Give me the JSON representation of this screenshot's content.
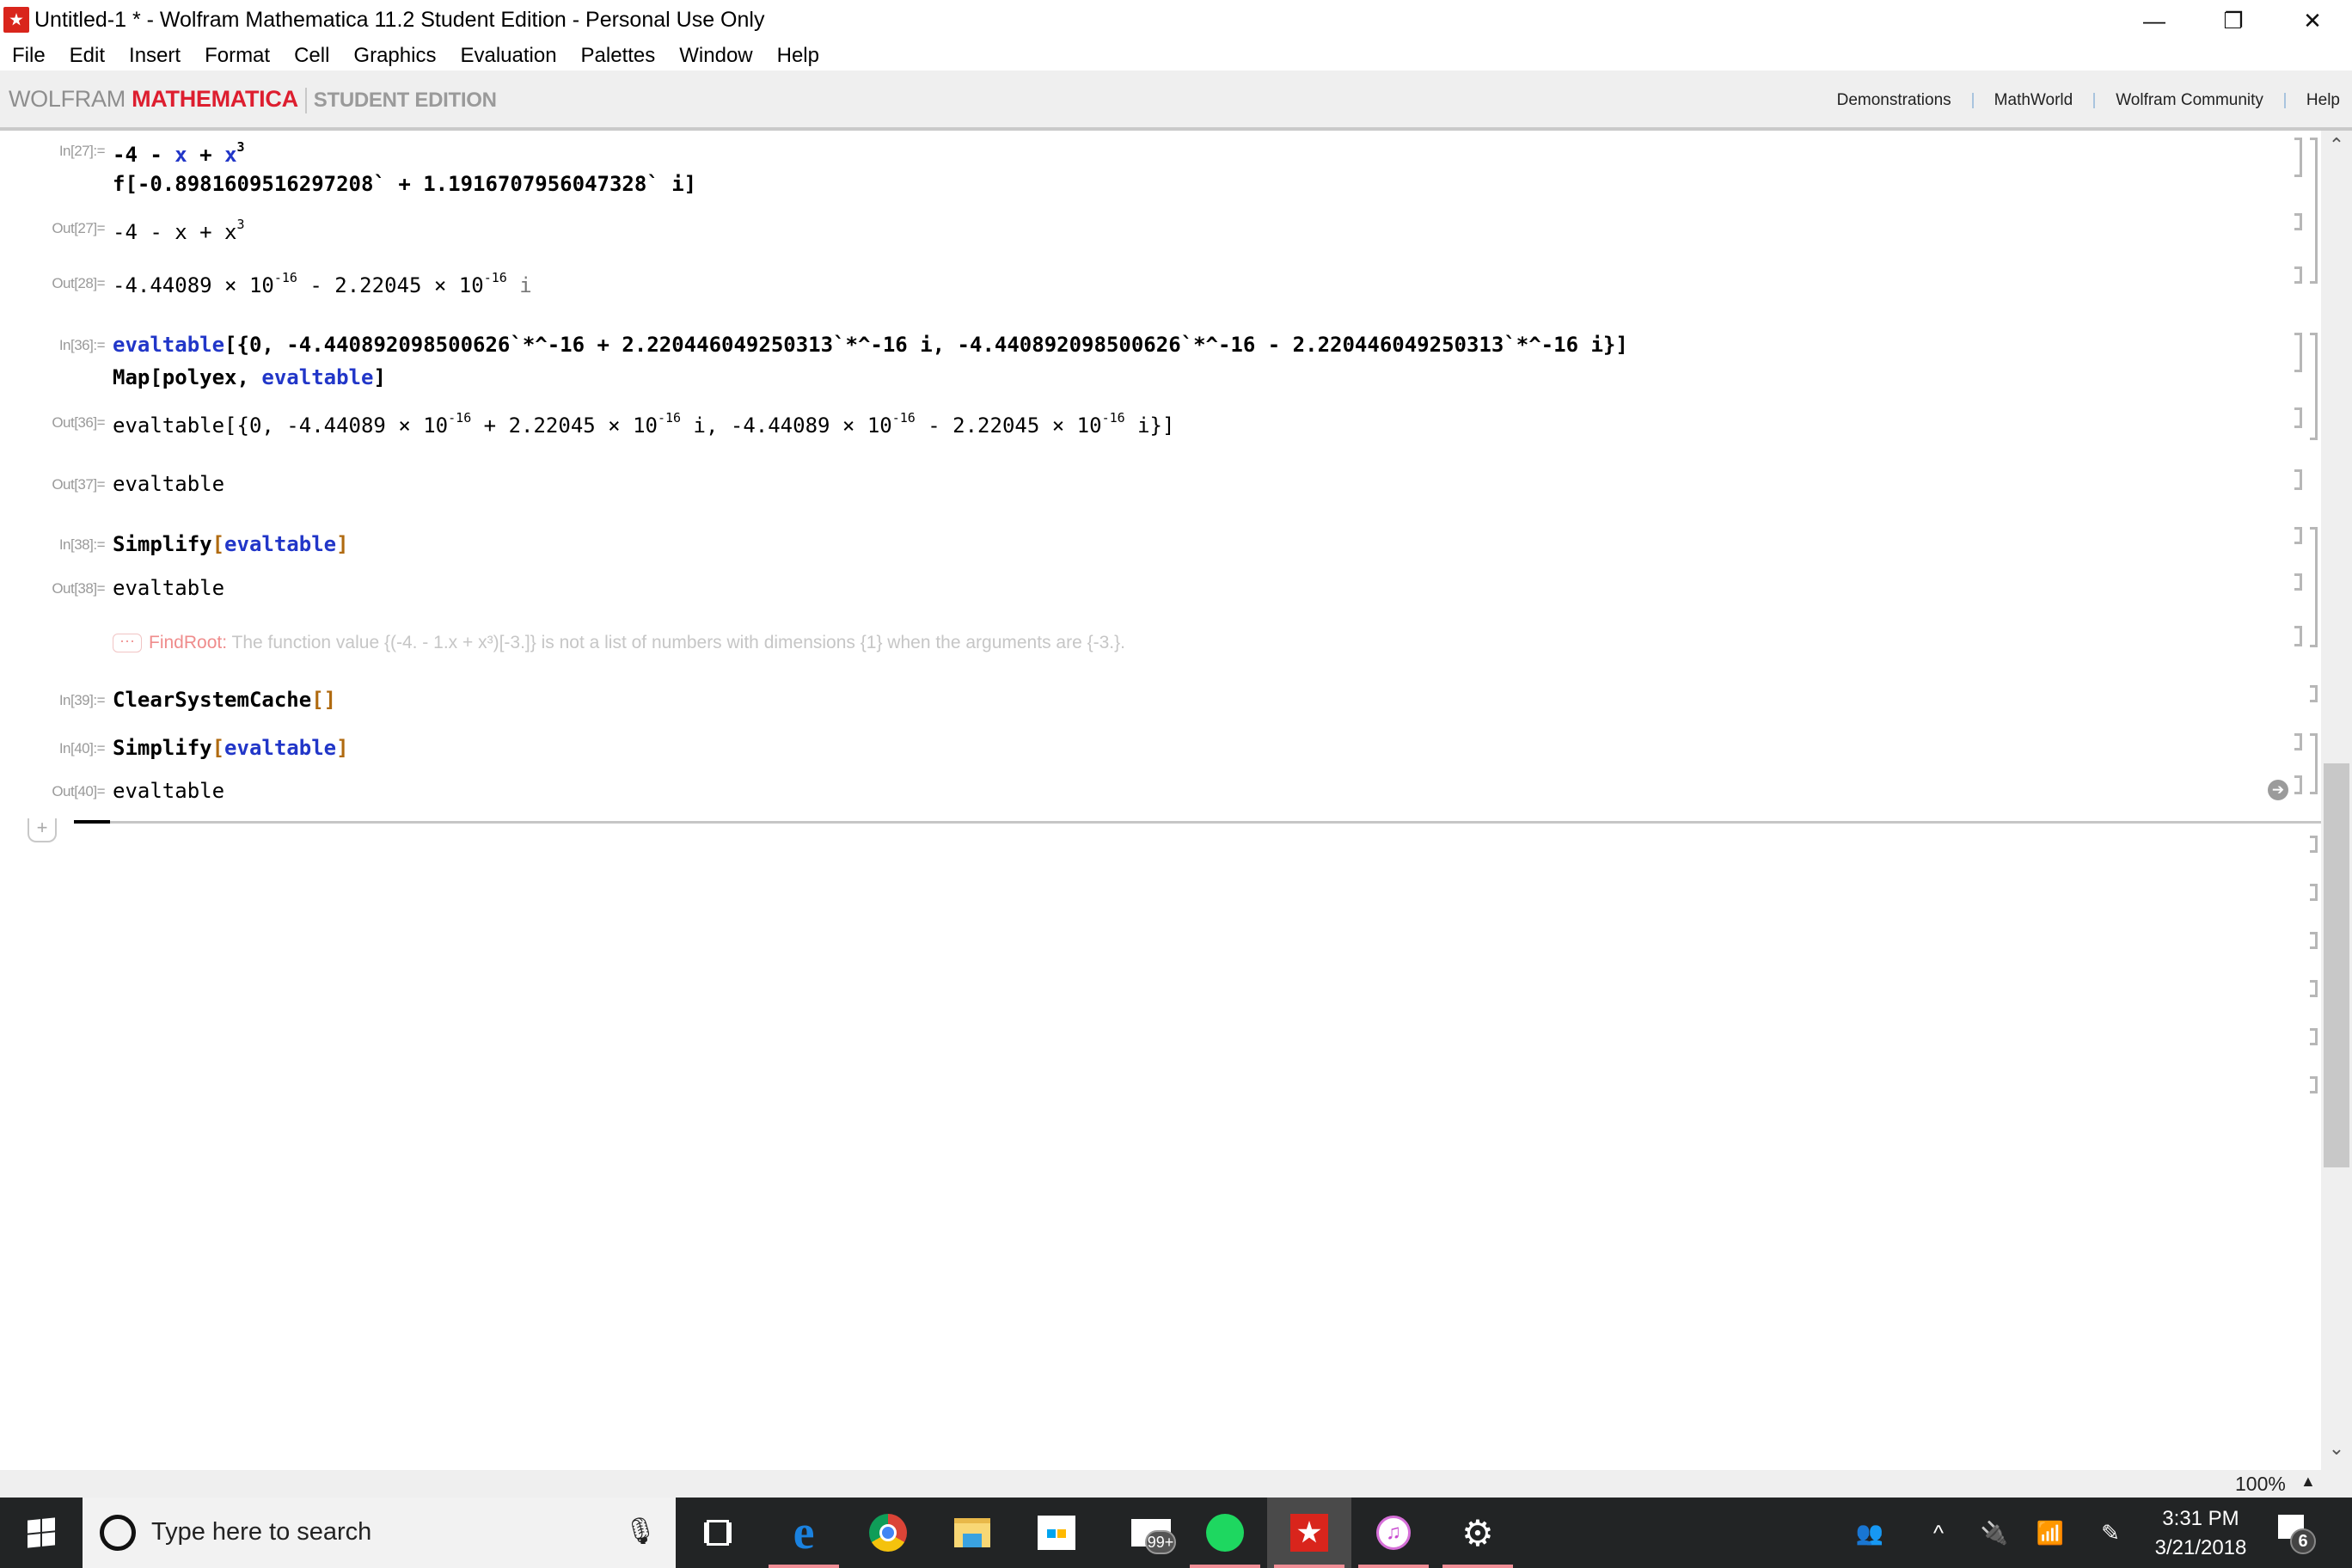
{
  "window": {
    "title": "Untitled-1 * - Wolfram Mathematica 11.2 Student Edition - Personal Use Only",
    "minimize": "—",
    "restore": "❐",
    "close": "✕"
  },
  "menu": [
    "File",
    "Edit",
    "Insert",
    "Format",
    "Cell",
    "Graphics",
    "Evaluation",
    "Palettes",
    "Window",
    "Help"
  ],
  "banner": {
    "brand_wolfram": "WOLFRAM",
    "brand_mathematica": "MATHEMATICA",
    "edition": "STUDENT EDITION",
    "links": [
      "Demonstrations",
      "MathWorld",
      "Wolfram Community",
      "Help"
    ]
  },
  "cells": {
    "in27_label": "In[27]:=",
    "in27_line1": {
      "a": "-4 - ",
      "x1": "x",
      "b": " + ",
      "x2": "x",
      "exp": "3"
    },
    "in27_line2": "f[-0.8981609516297208` + 1.1916707956047328` i]",
    "out27_label": "Out[27]=",
    "out27": {
      "text": "-4 - x + x",
      "exp": "3"
    },
    "out28_label": "Out[28]=",
    "out28": {
      "m1": "-4.44089 × 10",
      "e1": "-16",
      "m2": " - 2.22045 × 10",
      "e2": "-16",
      "i": " i"
    },
    "in36_label": "In[36]:=",
    "in36_line1": {
      "head": "evaltable",
      "body": "[{0, -4.440892098500626`*^-16 + 2.220446049250313`*^-16 i, -4.440892098500626`*^-16 - 2.220446049250313`*^-16 i}]"
    },
    "in36_line2": {
      "head": "Map[polyex, ",
      "arg": "evaltable",
      "close": "]"
    },
    "out36_label": "Out[36]=",
    "out36": {
      "head": "evaltable[{0, -4.44089 × 10",
      "e1": "-16",
      "p2": " + 2.22045 × 10",
      "e2": "-16",
      "p3": " i, -4.44089 × 10",
      "e3": "-16",
      "p4": " - 2.22045 × 10",
      "e4": "-16",
      "p5": " i}]"
    },
    "out37_label": "Out[37]=",
    "out37": "evaltable",
    "in38_label": "In[38]:=",
    "in38": {
      "head": "Simplify",
      "open": "[",
      "arg": "evaltable",
      "close": "]"
    },
    "out38_label": "Out[38]=",
    "out38": "evaltable",
    "message": {
      "dots": "···",
      "tag": "FindRoot:",
      "text": "The function value {(-4. - 1.x + x³)[-3.]} is not a list of numbers with dimensions {1} when the arguments are {-3.}."
    },
    "in39_label": "In[39]:=",
    "in39": {
      "head": "ClearSystemCache",
      "args": "[]"
    },
    "in40_label": "In[40]:=",
    "in40": {
      "head": "Simplify",
      "open": "[",
      "arg": "evaltable",
      "close": "]"
    },
    "out40_label": "Out[40]=",
    "out40": "evaltable",
    "add_cell": "+"
  },
  "status": {
    "zoom": "100%",
    "zoom_arrow": "▲"
  },
  "scrollbar": {
    "up": "⌃",
    "down": "⌄"
  },
  "taskbar": {
    "search_placeholder": "Type here to search",
    "mail_badge": "99+",
    "time": "3:31 PM",
    "date": "3/21/2018",
    "notifications": "6"
  },
  "colors": {
    "accent_red": "#dd1e2f",
    "code_blue": "#2136c8",
    "bracket_orange": "#b06a10",
    "taskbar_bg": "#222425"
  }
}
